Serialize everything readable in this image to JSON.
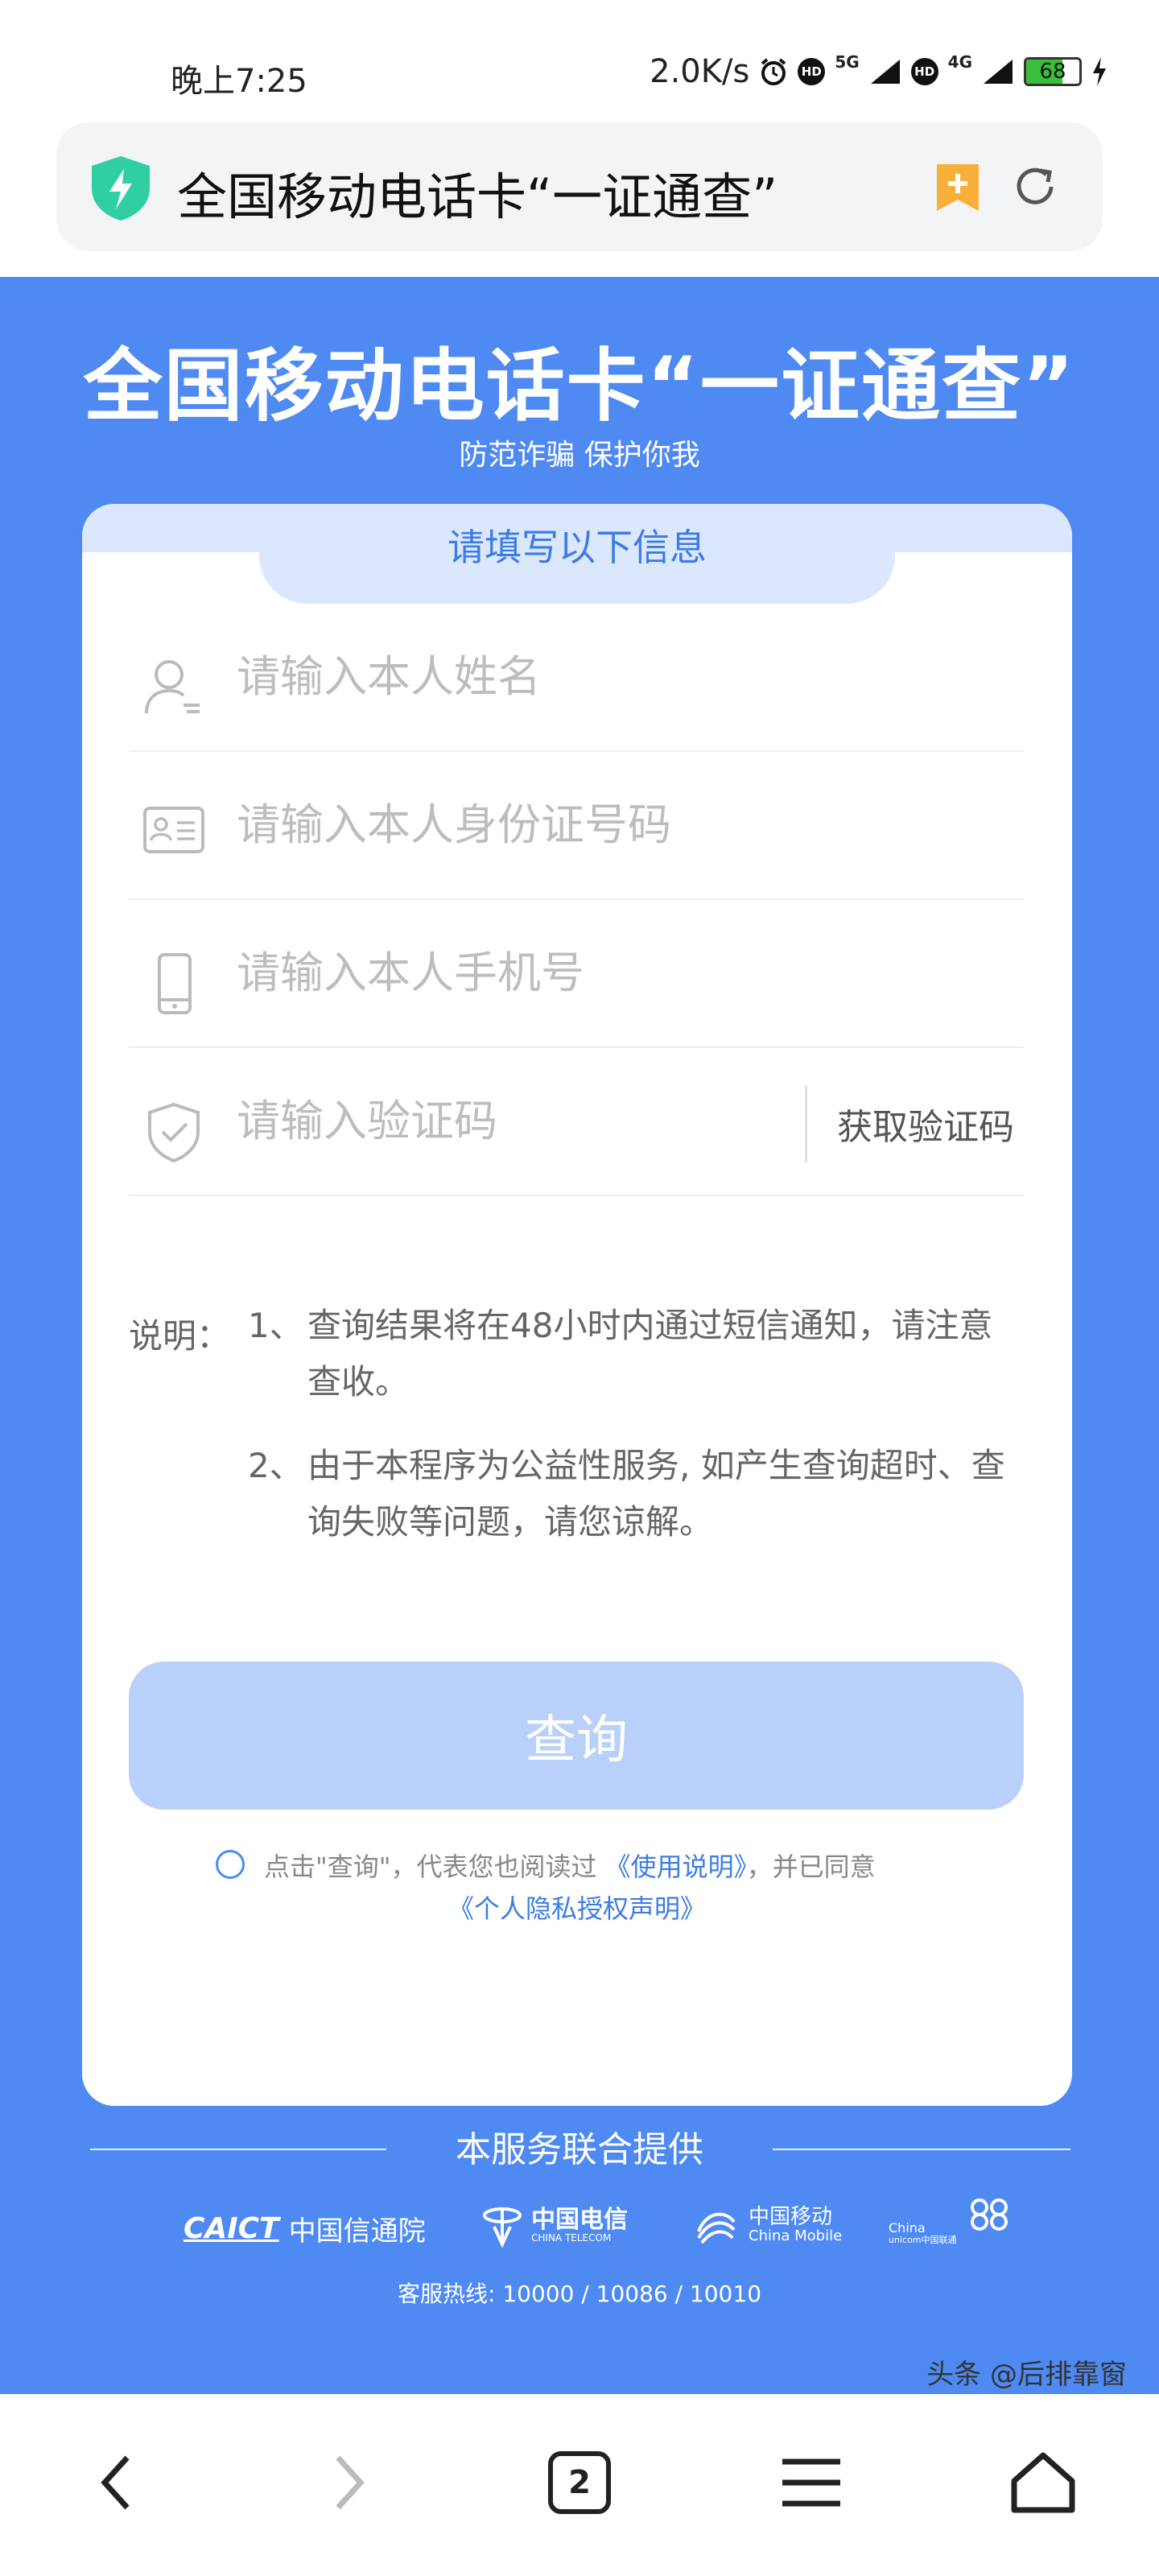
{
  "status_bar": {
    "time": "晚上7:25",
    "speed": "2.0K/s",
    "sim1_network": "5G",
    "sim2_network": "4G",
    "hd_label": "HD",
    "battery": "68",
    "icons": [
      "alarm-icon",
      "hd-icon",
      "signal-icon",
      "charging-icon"
    ]
  },
  "browser": {
    "page_title": "全国移动电话卡“一证通查”",
    "icons": [
      "shield-icon",
      "bookmark-add-icon",
      "reload-icon"
    ],
    "accent_colors": {
      "shield": "#2fcfa1",
      "bookmark": "#f7b03a"
    }
  },
  "hero": {
    "title": "全国移动电话卡“一证通查”",
    "subtitle": "防范诈骗 保护你我"
  },
  "form": {
    "header": "请填写以下信息",
    "name_placeholder": "请输入本人姓名",
    "id_placeholder": "请输入本人身份证号码",
    "phone_placeholder": "请输入本人手机号",
    "code_placeholder": "请输入验证码",
    "get_code_label": "获取验证码",
    "notes_label": "说明：",
    "notes": [
      {
        "num": "1、",
        "text": "查询结果将在48小时内通过短信通知，请注意查收。"
      },
      {
        "num": "2、",
        "text": "由于本程序为公益性服务, 如产生查询超时、查询失败等问题，请您谅解。"
      }
    ],
    "query_button": "查询",
    "agree_prefix": "点击\"查询\"，代表您也阅读过",
    "agree_link1": "《使用说明》",
    "agree_middle": "，并已同意",
    "agree_link2": "《个人隐私授权声明》"
  },
  "partners": {
    "heading": "本服务联合提供",
    "logos": [
      {
        "mark": "CAICT",
        "name": "中国信通院"
      },
      {
        "mark": "中国电信",
        "name": "CHINA TELECOM"
      },
      {
        "mark": "中国移动",
        "name": "China Mobile"
      },
      {
        "mark": "China",
        "name": "unicom中国联通"
      }
    ],
    "hotline": "客服热线: 10000 / 10086 / 10010"
  },
  "bottom_nav": {
    "tab_count": "2",
    "watermark": "头条 @后排靠窗"
  },
  "colors": {
    "primary": "#4f8af3",
    "card_tab": "#dbe7fd",
    "button_disabled": "#b9d0fa",
    "link": "#3d7be6"
  }
}
